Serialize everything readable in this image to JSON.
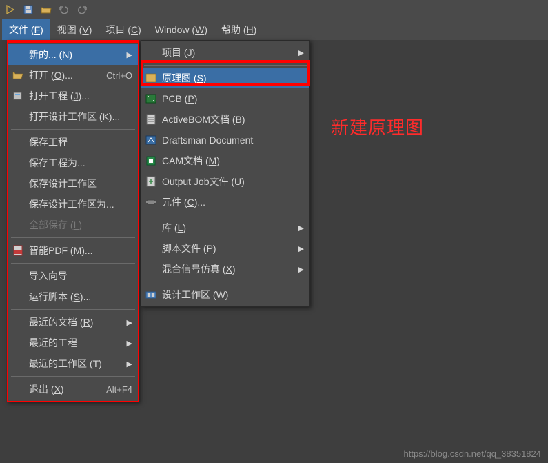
{
  "toolbar": {
    "icons": [
      "logo-icon",
      "save-icon",
      "folder-open-icon",
      "undo-icon",
      "redo-icon"
    ]
  },
  "menubar": {
    "items": [
      {
        "label": "文件 (",
        "mn": "F",
        "suffix": ")",
        "active": true
      },
      {
        "label": "视图 (",
        "mn": "V",
        "suffix": ")",
        "active": false
      },
      {
        "label": "项目 (",
        "mn": "C",
        "suffix": ")",
        "active": false
      },
      {
        "label": "Window (",
        "mn": "W",
        "suffix": ")",
        "active": false
      },
      {
        "label": "帮助 (",
        "mn": "H",
        "suffix": ")",
        "active": false
      }
    ]
  },
  "file_menu": {
    "items": [
      {
        "label": "新的... (",
        "mn": "N",
        "suffix": ")",
        "shortcut": "",
        "arrow": true,
        "icon": "",
        "highlighted": true
      },
      {
        "label": "打开 (",
        "mn": "O",
        "suffix": ")...",
        "shortcut": "Ctrl+O",
        "icon": "folder-open-icon"
      },
      {
        "label": "打开工程 (",
        "mn": "J",
        "suffix": ")...",
        "icon": "project-icon"
      },
      {
        "label": "打开设计工作区 (",
        "mn": "K",
        "suffix": ")...",
        "icon": ""
      },
      {
        "sep": true
      },
      {
        "label": "保存工程",
        "icon": ""
      },
      {
        "label": "保存工程为...",
        "icon": ""
      },
      {
        "label": "保存设计工作区",
        "icon": ""
      },
      {
        "label": "保存设计工作区为...",
        "icon": ""
      },
      {
        "label": "全部保存 (",
        "mn": "L",
        "suffix": ")",
        "disabled": true,
        "icon": ""
      },
      {
        "sep": true
      },
      {
        "label": "智能PDF (",
        "mn": "M",
        "suffix": ")...",
        "icon": "pdf-icon"
      },
      {
        "sep": true
      },
      {
        "label": "导入向导",
        "icon": ""
      },
      {
        "label": "运行脚本 (",
        "mn": "S",
        "suffix": ")...",
        "icon": ""
      },
      {
        "sep": true
      },
      {
        "label": "最近的文档 (",
        "mn": "R",
        "suffix": ")",
        "arrow": true,
        "icon": ""
      },
      {
        "label": "最近的工程",
        "arrow": true,
        "icon": ""
      },
      {
        "label": "最近的工作区 (",
        "mn": "T",
        "suffix": ")",
        "arrow": true,
        "icon": ""
      },
      {
        "sep": true
      },
      {
        "label": "退出 (",
        "mn": "X",
        "suffix": ")",
        "shortcut": "Alt+F4",
        "icon": ""
      }
    ]
  },
  "submenu": {
    "items": [
      {
        "label": "项目 (",
        "mn": "J",
        "suffix": ")",
        "arrow": true,
        "icon": ""
      },
      {
        "sep": true
      },
      {
        "label": "原理图 (",
        "mn": "S",
        "suffix": ")",
        "icon": "schematic-icon",
        "highlighted": true
      },
      {
        "label": "PCB (",
        "mn": "P",
        "suffix": ")",
        "icon": "pcb-icon"
      },
      {
        "label": "ActiveBOM文档 (",
        "mn": "B",
        "suffix": ")",
        "icon": "bom-icon"
      },
      {
        "label": "Draftsman Document",
        "icon": "draftsman-icon"
      },
      {
        "label": "CAM文档 (",
        "mn": "M",
        "suffix": ")",
        "icon": "cam-icon"
      },
      {
        "label": "Output Job文件 (",
        "mn": "U",
        "suffix": ")",
        "icon": "output-icon"
      },
      {
        "label": "元件 (",
        "mn": "C",
        "suffix": ")...",
        "icon": "component-icon"
      },
      {
        "sep": true
      },
      {
        "label": "库 (",
        "mn": "L",
        "suffix": ")",
        "arrow": true,
        "icon": ""
      },
      {
        "label": "脚本文件 (",
        "mn": "P",
        "suffix": ")",
        "arrow": true,
        "icon": ""
      },
      {
        "label": "混合信号仿真 (",
        "mn": "X",
        "suffix": ")",
        "arrow": true,
        "icon": ""
      },
      {
        "sep": true
      },
      {
        "label": "设计工作区 (",
        "mn": "W",
        "suffix": ")",
        "icon": "workspace-icon"
      }
    ]
  },
  "annotation": "新建原理图",
  "watermark": "https://blog.csdn.net/qq_38351824"
}
